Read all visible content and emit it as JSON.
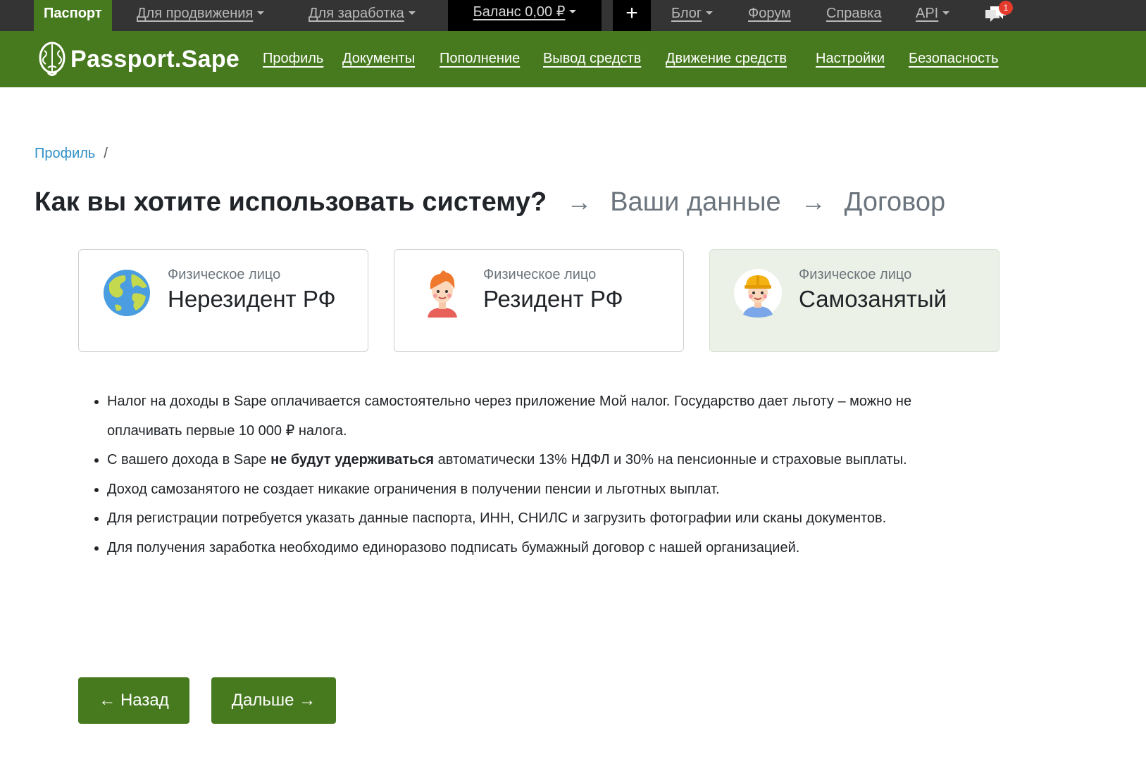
{
  "topbar": {
    "passport": "Паспорт",
    "promotion": "Для продвижения",
    "earning": "Для заработка",
    "balance": "Баланс 0,00 ₽",
    "plus": "+",
    "blog": "Блог",
    "forum": "Форум",
    "help": "Справка",
    "api": "API",
    "notification_count": "1"
  },
  "brand": {
    "name": "Passport.Sape"
  },
  "nav": {
    "profile": "Профиль",
    "documents": "Документы",
    "topup": "Пополнение",
    "withdraw": "Вывод средств",
    "movement": "Движение средств",
    "settings": "Настройки",
    "security": "Безопасность"
  },
  "breadcrumb": {
    "item": "Профиль",
    "separator": "/"
  },
  "steps": {
    "step1": "Как вы хотите использовать систему?",
    "step2": "Ваши данные",
    "step3": "Договор",
    "arrow": "→"
  },
  "cards": [
    {
      "subtitle": "Физическое лицо",
      "title": "Нерезидент РФ",
      "icon": "globe-icon"
    },
    {
      "subtitle": "Физическое лицо",
      "title": "Резидент РФ",
      "icon": "person-icon"
    },
    {
      "subtitle": "Физическое лицо",
      "title": "Самозанятый",
      "icon": "worker-icon",
      "selected": true
    }
  ],
  "bullets": {
    "b1": "Налог на доходы в Sape оплачивается самостоятельно через приложение Мой налог. Государство дает льготу – можно не оплачивать первые 10 000 ₽ налога.",
    "b2_pre": "С вашего дохода в Sape ",
    "b2_bold": "не будут удерживаться",
    "b2_post": " автоматически 13% НДФЛ и 30% на пенсионные и страховые выплаты.",
    "b3": "Доход самозанятого не создает никакие ограничения в получении пенсии и льготных выплат.",
    "b4": "Для регистрации потребуется указать данные паспорта, ИНН, СНИЛС и загрузить фотографии или сканы документов.",
    "b5": "Для получения заработка необходимо единоразово подписать бумажный договор с нашей организацией."
  },
  "buttons": {
    "back": "← Назад",
    "next": "Дальше →"
  },
  "colors": {
    "brand_green": "#477a1e",
    "topbar_dark": "#343434",
    "selected_card_bg": "#ebf1e6",
    "link_blue": "#2f8fc8",
    "badge_red": "#e43b2c"
  }
}
